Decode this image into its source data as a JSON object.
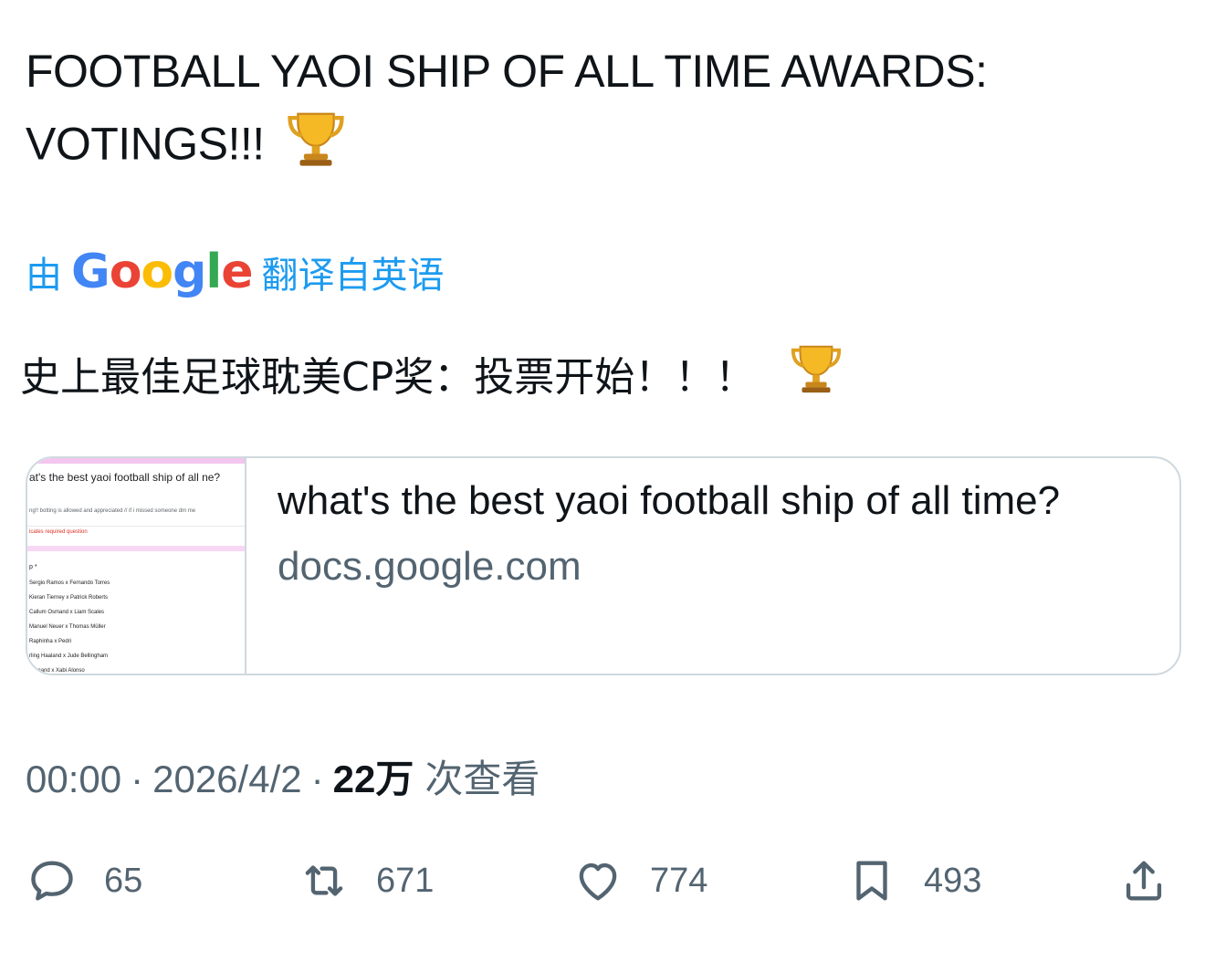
{
  "tweet": {
    "text": "FOOTBALL YAOI SHIP OF ALL TIME AWARDS: VOTINGS!!!",
    "emoji": "🏆"
  },
  "translation": {
    "prefix": "由",
    "brand": "Google",
    "suffix": "翻译自英语",
    "text": "史上最佳足球耽美CP奖：投票开始！！！"
  },
  "link_card": {
    "title": "what's the best yaoi football ship of all time?",
    "domain": "docs.google.com",
    "thumbnail": {
      "title": "at's the best yaoi football ship of all ne?",
      "subtitle": "ng!! botting is allowed and appreciated // if i missed someone dm me",
      "required": "icates required question",
      "question": "p *",
      "options": [
        "Sergio Ramos x Fernando Torres",
        "Kieran Tierney x Patrick Roberts",
        "Callum Osmand x Liam Scales",
        "Manuel Neuer x Thomas Müller",
        "Raphinha x Pedri",
        "rling Haaland x Jude Bellingham",
        "Osmand x Xabi Alonso"
      ]
    }
  },
  "meta": {
    "time": "00:00",
    "date": "2026/4/2",
    "views_count": "22万",
    "views_label": "次查看",
    "separator": "·"
  },
  "actions": {
    "reply": "65",
    "retweet": "671",
    "like": "774",
    "bookmark": "493"
  }
}
